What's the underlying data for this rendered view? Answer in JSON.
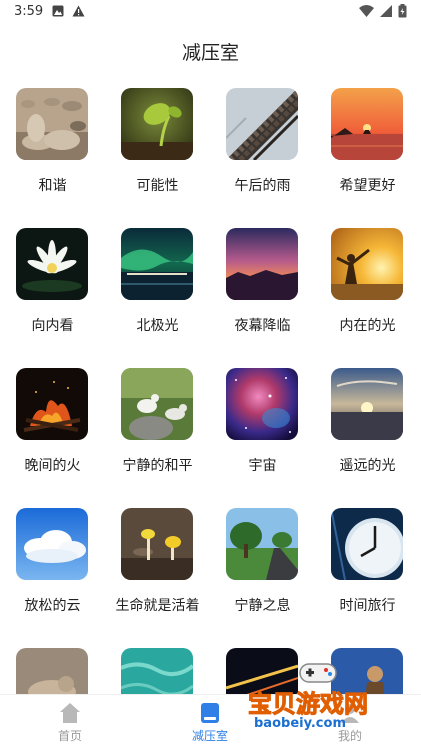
{
  "status_bar": {
    "time": "3:59"
  },
  "header": {
    "title": "减压室"
  },
  "items": [
    {
      "label": "和谐",
      "icon": "stones"
    },
    {
      "label": "可能性",
      "icon": "sprout"
    },
    {
      "label": "午后的雨",
      "icon": "rooftop"
    },
    {
      "label": "希望更好",
      "icon": "sunset-sea"
    },
    {
      "label": "向内看",
      "icon": "water-lily"
    },
    {
      "label": "北极光",
      "icon": "aurora"
    },
    {
      "label": "夜幕降临",
      "icon": "dusk"
    },
    {
      "label": "内在的光",
      "icon": "person-sunlight"
    },
    {
      "label": "晚间的火",
      "icon": "bonfire"
    },
    {
      "label": "宁静的和平",
      "icon": "doves"
    },
    {
      "label": "宇宙",
      "icon": "nebula"
    },
    {
      "label": "遥远的光",
      "icon": "horizon-sun"
    },
    {
      "label": "放松的云",
      "icon": "clouds"
    },
    {
      "label": "生命就是活着",
      "icon": "mushrooms"
    },
    {
      "label": "宁静之息",
      "icon": "tree-road"
    },
    {
      "label": "时间旅行",
      "icon": "clock"
    },
    {
      "label": "",
      "icon": "cat"
    },
    {
      "label": "",
      "icon": "turquoise-water"
    },
    {
      "label": "",
      "icon": "night-road"
    },
    {
      "label": "",
      "icon": "figure"
    }
  ],
  "nav": {
    "home": "首页",
    "decompression": "减压室",
    "mine": "我的",
    "active_color": "#2f7fe6",
    "inactive_color": "#b8b8b8"
  },
  "watermark": {
    "title": "宝贝游戏网",
    "url": "baobeiy.com"
  }
}
